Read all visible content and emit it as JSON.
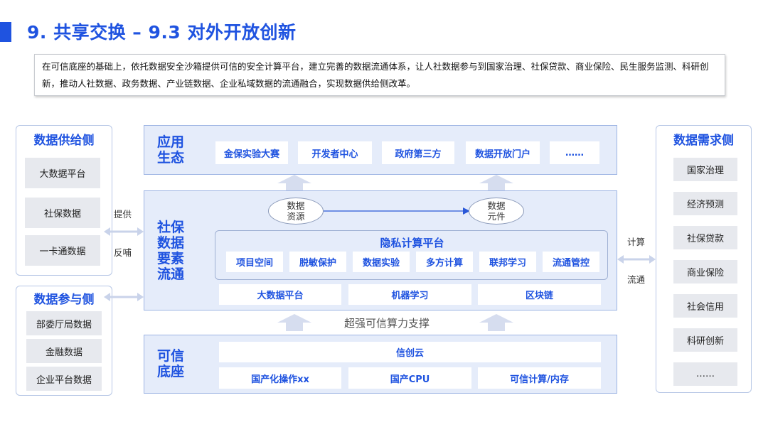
{
  "header": {
    "title": "9. 共享交换 – 9.3 对外开放创新"
  },
  "intro": {
    "text": "在可信底座的基础上，依托数据安全沙箱提供可信的安全计算平台，建立完善的数据流通体系，让人社数据参与到国家治理、社保贷款、商业保险、民生服务监测、科研创新，推动人社数据、政务数据、产业链数据、企业私域数据的流通融合，实现数据供给侧改革。"
  },
  "left": {
    "supply": {
      "title": "数据供给侧",
      "items": [
        "大数据平台",
        "社保数据",
        "一卡通数据"
      ]
    },
    "participate": {
      "title": "数据参与侧",
      "items": [
        "部委厅局数据",
        "金融数据",
        "企业平台数据"
      ]
    },
    "labels": {
      "provide": "提供",
      "feedback": "反哺"
    }
  },
  "right": {
    "title": "数据需求侧",
    "items": [
      "国家治理",
      "经济预测",
      "社保贷款",
      "商业保险",
      "社会信用",
      "科研创新",
      "……"
    ],
    "labels": {
      "compute": "计算",
      "circulate": "流通"
    }
  },
  "app": {
    "title": [
      "应用",
      "生态"
    ],
    "items": [
      "金保实验大赛",
      "开发者中心",
      "政府第三方",
      "数据开放门户",
      "……"
    ]
  },
  "core": {
    "title": [
      "社保",
      "数据",
      "要素",
      "流通"
    ],
    "source": [
      "数据",
      "资源"
    ],
    "component": [
      "数据",
      "元件"
    ],
    "privacy_title": "隐私计算平台",
    "privacy_items": [
      "项目空间",
      "脱敏保护",
      "数据实验",
      "多方计算",
      "联邦学习",
      "流通管控"
    ],
    "bottom_items": [
      "大数据平台",
      "机器学习",
      "区块链"
    ]
  },
  "support": {
    "text": "超强可信算力支撑"
  },
  "base": {
    "title": [
      "可信",
      "底座"
    ],
    "cloud": "信创云",
    "items": [
      "国产化操作xx",
      "国产CPU",
      "可信计算/内存"
    ]
  },
  "colors": {
    "accent": "#1f53e0",
    "layer_bg": "#e5ecfa",
    "gray_box": "#e7e9ee",
    "arrow": "#d6ddef"
  }
}
